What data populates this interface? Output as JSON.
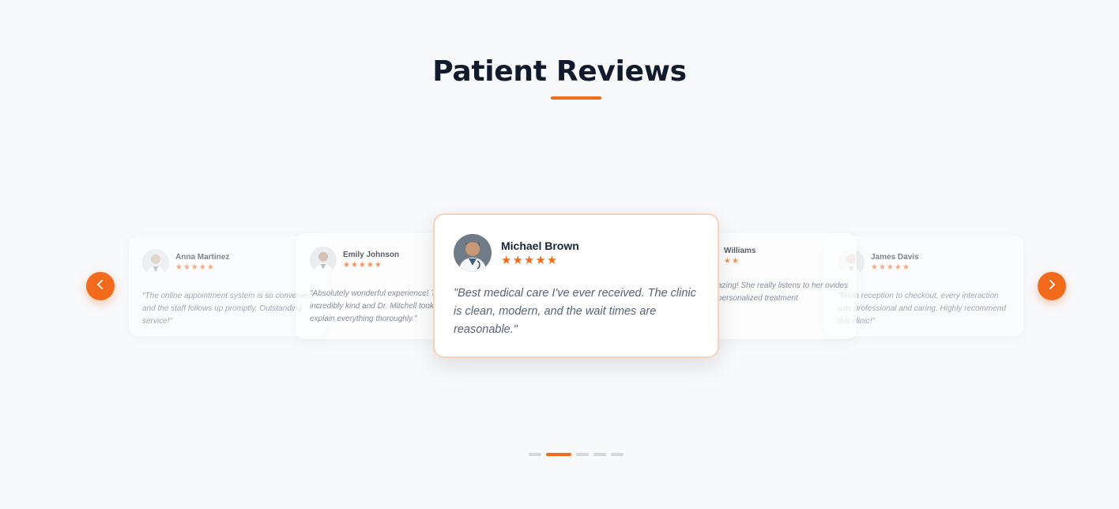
{
  "section": {
    "title": "Patient Reviews"
  },
  "reviews": [
    {
      "name": "Anna Martinez",
      "stars": "★★★★★",
      "quote": "\"The online appointment system is so convenient and the staff follows up promptly. Outstanding service!\""
    },
    {
      "name": "Emily Johnson",
      "stars": "★★★★★",
      "quote": "\"Absolutely wonderful experience! The staff was incredibly kind and Dr. Mitchell took the time to explain everything thoroughly.\""
    },
    {
      "name": "Michael Brown",
      "stars": "★★★★★",
      "quote": "\"Best medical care I've ever received. The clinic is clean, modern, and the wait times are reasonable.\""
    },
    {
      "name": "Williams",
      "stars": "★★",
      "quote": "azing! She really listens to her ovides personalized treatment"
    },
    {
      "name": "James Davis",
      "stars": "★★★★★",
      "quote": "\"From reception to checkout, every interaction was professional and caring. Highly recommend this clinic!\""
    }
  ],
  "carousel": {
    "active_index": 2,
    "dot_count": 5
  },
  "colors": {
    "accent": "#f26b1d",
    "title": "#111b2e",
    "background": "#f8f9fb"
  },
  "icons": {
    "prev": "chevron-left-icon",
    "next": "chevron-right-icon"
  }
}
